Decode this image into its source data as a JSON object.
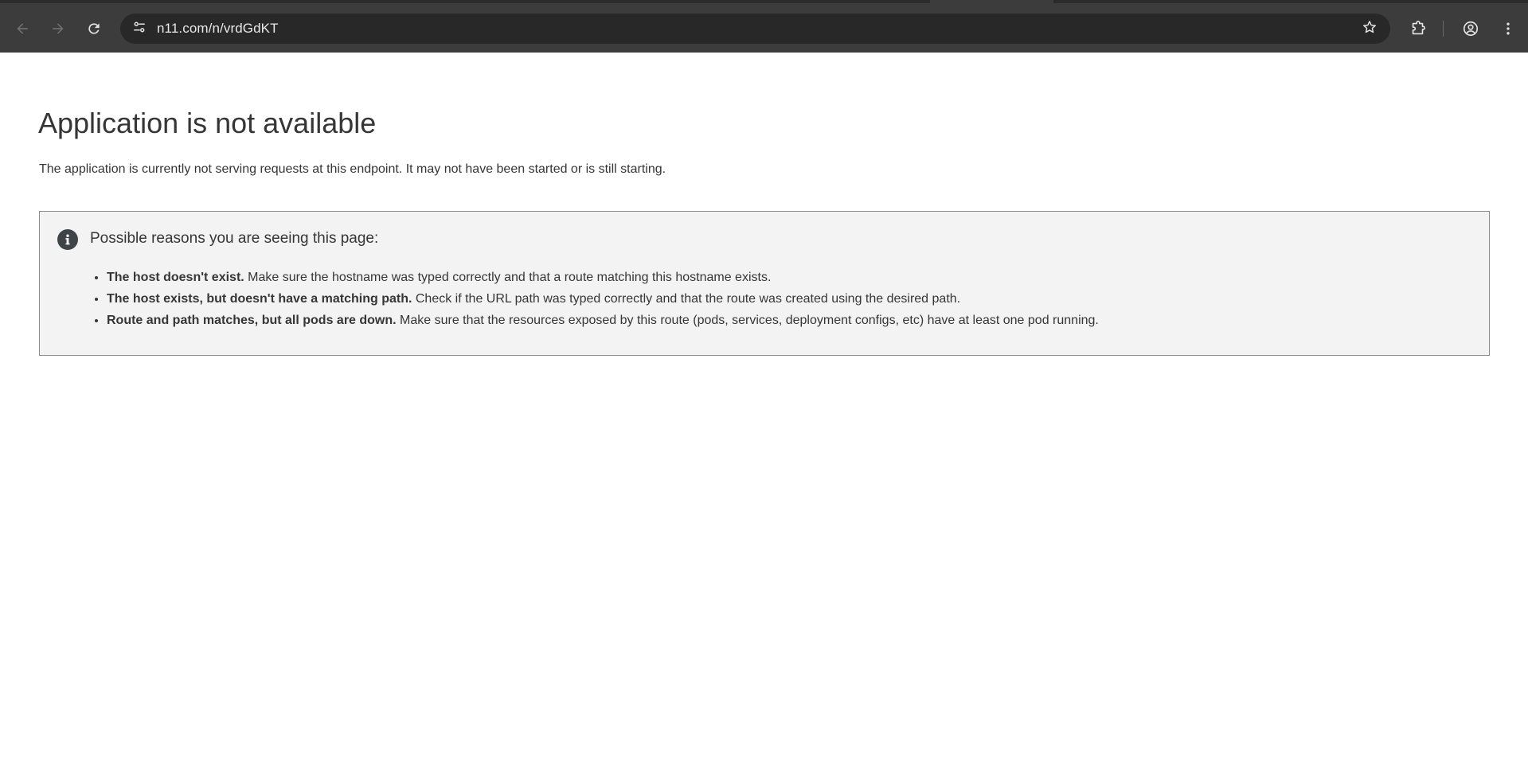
{
  "browser": {
    "url": "n11.com/n/vrdGdKT",
    "icons": {
      "back": "back-arrow-icon",
      "forward": "forward-arrow-icon",
      "reload": "reload-icon",
      "site_info": "tune-icon",
      "bookmark": "star-icon",
      "extensions": "puzzle-icon",
      "profile": "account-circle-icon",
      "menu": "more-vert-icon"
    }
  },
  "page": {
    "title": "Application is not available",
    "description": "The application is currently not serving requests at this endpoint. It may not have been started or is still starting.",
    "alert": {
      "icon": "info-icon",
      "heading": "Possible reasons you are seeing this page:",
      "reasons": [
        {
          "bold": "The host doesn't exist.",
          "text": " Make sure the hostname was typed correctly and that a route matching this hostname exists."
        },
        {
          "bold": "The host exists, but doesn't have a matching path.",
          "text": " Check if the URL path was typed correctly and that the route was created using the desired path."
        },
        {
          "bold": "Route and path matches, but all pods are down.",
          "text": " Make sure that the resources exposed by this route (pods, services, deployment configs, etc) have at least one pod running."
        }
      ]
    }
  },
  "colors": {
    "chrome_bg": "#3c3c3c",
    "omnibox_bg": "#282828",
    "alert_bg": "#f3f3f3",
    "alert_border": "#8b8d8f",
    "text": "#363636"
  }
}
